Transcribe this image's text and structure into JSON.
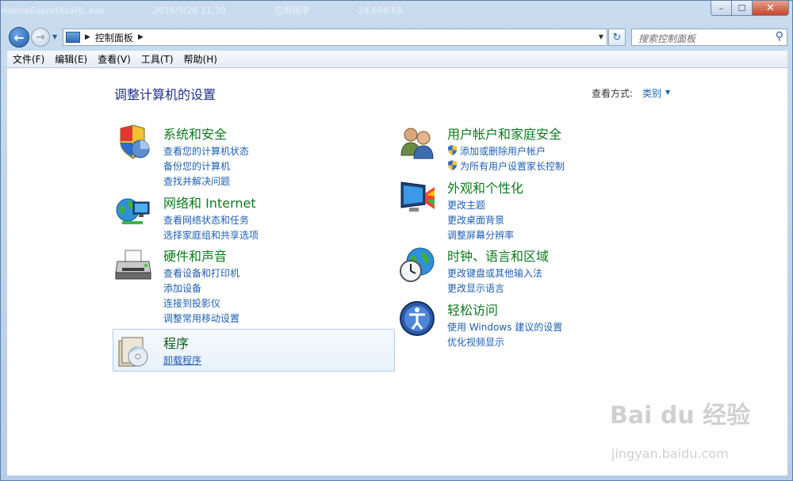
{
  "window": {
    "title_ghost": [
      "rHomeExportAsaHL.exe",
      "2016/5/26 11:30",
      "应用程序",
      "24,696 KB"
    ],
    "caption": {
      "minimize": "–",
      "maximize": "☐",
      "close": "✕"
    }
  },
  "nav": {
    "back_glyph": "←",
    "forward_glyph": "→",
    "breadcrumb": [
      "控制面板"
    ],
    "refresh_glyph": "↻",
    "search_placeholder": "搜索控制面板"
  },
  "menu": [
    "文件(F)",
    "编辑(E)",
    "查看(V)",
    "工具(T)",
    "帮助(H)"
  ],
  "page": {
    "title": "调整计算机的设置",
    "view_by_label": "查看方式:",
    "view_by_value": "类别"
  },
  "categories": [
    {
      "title": "系统和安全",
      "icon": "shield-security-icon",
      "links": [
        "查看您的计算机状态",
        "备份您的计算机",
        "查找并解决问题"
      ]
    },
    {
      "title": "网络和 Internet",
      "icon": "network-globe-icon",
      "links": [
        "查看网络状态和任务",
        "选择家庭组和共享选项"
      ]
    },
    {
      "title": "硬件和声音",
      "icon": "printer-icon",
      "links": [
        "查看设备和打印机",
        "添加设备",
        "连接到投影仪",
        "调整常用移动设置"
      ]
    },
    {
      "title": "程序",
      "icon": "programs-disc-icon",
      "links": [
        "卸载程序"
      ]
    },
    {
      "title": "用户帐户和家庭安全",
      "icon": "users-icon",
      "links": [
        "添加或删除用户帐户",
        "为所有用户设置家长控制"
      ]
    },
    {
      "title": "外观和个性化",
      "icon": "monitor-paint-icon",
      "links": [
        "更改主题",
        "更改桌面背景",
        "调整屏幕分辨率"
      ]
    },
    {
      "title": "时钟、语言和区域",
      "icon": "globe-clock-icon",
      "links": [
        "更改键盘或其他输入法",
        "更改显示语言"
      ]
    },
    {
      "title": "轻松访问",
      "icon": "ease-of-access-icon",
      "links": [
        "使用 Windows 建议的设置",
        "优化视频显示"
      ]
    }
  ],
  "watermark": {
    "text": "Bai du 经验",
    "sub": "jingyan.baidu.com"
  },
  "colors": {
    "category_title": "#0c7a1d",
    "link": "#1e5fb4",
    "page_title": "#1e3287"
  }
}
